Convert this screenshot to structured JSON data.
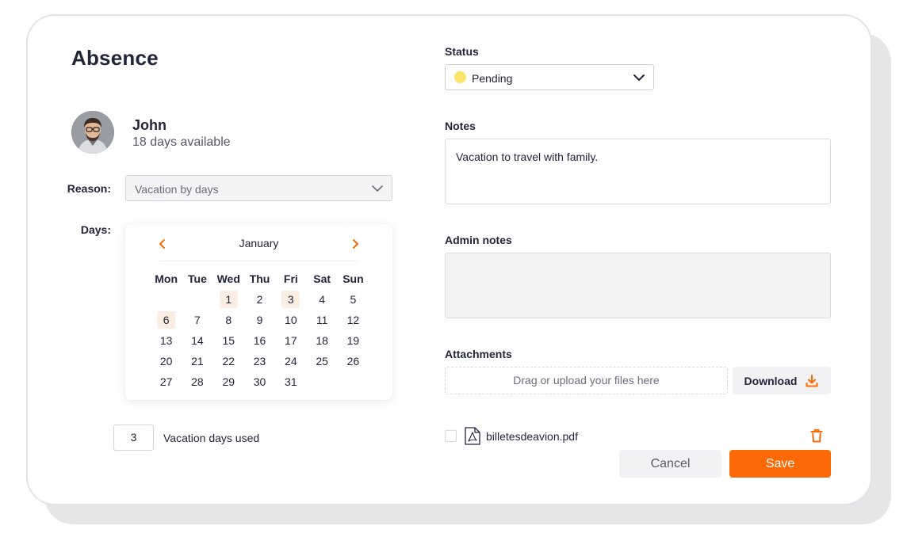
{
  "header": {
    "title": "Absence"
  },
  "user": {
    "name": "John",
    "available": "18 days available"
  },
  "reason": {
    "label": "Reason:",
    "value": "Vacation by days"
  },
  "days": {
    "label": "Days:"
  },
  "calendar": {
    "month": "January",
    "weekdays": [
      "Mon",
      "Tue",
      "Wed",
      "Thu",
      "Fri",
      "Sat",
      "Sun"
    ],
    "weeks": [
      [
        "",
        "",
        "1",
        "2",
        "3",
        "4",
        "5"
      ],
      [
        "6",
        "7",
        "8",
        "9",
        "10",
        "11",
        "12"
      ],
      [
        "13",
        "14",
        "15",
        "16",
        "17",
        "18",
        "19"
      ],
      [
        "20",
        "21",
        "22",
        "23",
        "24",
        "25",
        "26"
      ],
      [
        "27",
        "28",
        "29",
        "30",
        "31",
        "",
        ""
      ]
    ],
    "selected": [
      "1",
      "3",
      "6"
    ]
  },
  "vacation_used": {
    "count": "3",
    "label": "Vacation days used"
  },
  "status": {
    "label": "Status",
    "value": "Pending",
    "color": "#fbe46a"
  },
  "notes": {
    "label": "Notes",
    "value": "Vacation to travel with family."
  },
  "admin_notes": {
    "label": "Admin notes",
    "value": ""
  },
  "attachments": {
    "label": "Attachments",
    "drop_text": "Drag or upload your files here",
    "download_label": "Download",
    "files": [
      {
        "name": "billetesdeavion.pdf"
      }
    ]
  },
  "actions": {
    "cancel_label": "Cancel",
    "save_label": "Save"
  },
  "colors": {
    "accent": "#fb6a06",
    "selected_day_bg": "#fdeee3"
  }
}
